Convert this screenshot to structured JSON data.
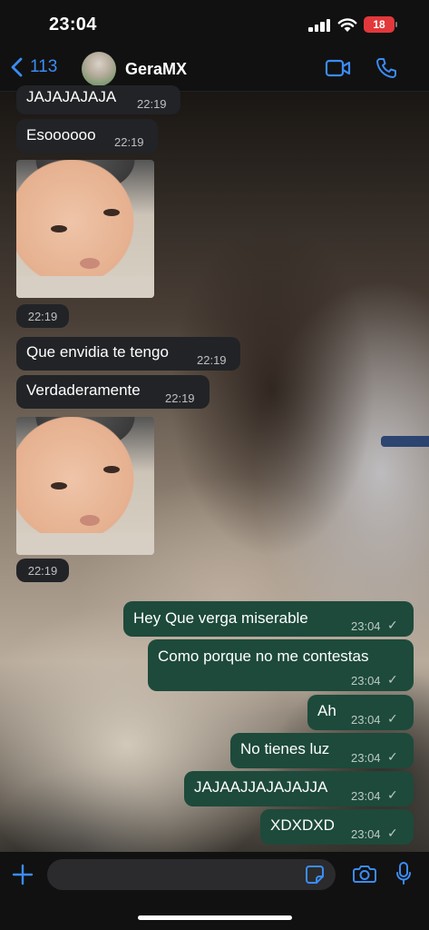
{
  "status_bar": {
    "time": "23:04",
    "battery": "18"
  },
  "header": {
    "back_count": "113",
    "contact_name": "GeraMX"
  },
  "messages": {
    "m1": {
      "text": "JAJAJAJAJA",
      "time": "22:19"
    },
    "m2": {
      "text": "Esoooooo",
      "time": "22:19"
    },
    "img1": {
      "time": "22:19"
    },
    "m3": {
      "text": "Que envidia te tengo",
      "time": "22:19"
    },
    "m4": {
      "text": "Verdaderamente",
      "time": "22:19"
    },
    "img2": {
      "time": "22:19"
    },
    "o1": {
      "text": "Hey Que verga miserable",
      "time": "23:04"
    },
    "o2": {
      "text": "Como porque no me contestas",
      "time": "23:04"
    },
    "o3": {
      "text": "Ah",
      "time": "23:04"
    },
    "o4": {
      "text": "No tienes luz",
      "time": "23:04"
    },
    "o5": {
      "text": "JAJAAJJAJAJAJJA",
      "time": "23:04"
    },
    "o6": {
      "text": "XDXDXD",
      "time": "23:04"
    }
  },
  "composer": {
    "placeholder": ""
  },
  "icons": {
    "back": "chevron-left-icon",
    "video": "video-camera-icon",
    "call": "phone-icon",
    "plus": "plus-icon",
    "sticker": "sticker-icon",
    "camera": "camera-icon",
    "mic": "microphone-icon",
    "read": "checkmark-icon"
  },
  "colors": {
    "accent": "#3b8cf5",
    "incoming_bubble": "#222326",
    "outgoing_bubble": "#1d4a3b",
    "battery_low": "#e2383b"
  }
}
